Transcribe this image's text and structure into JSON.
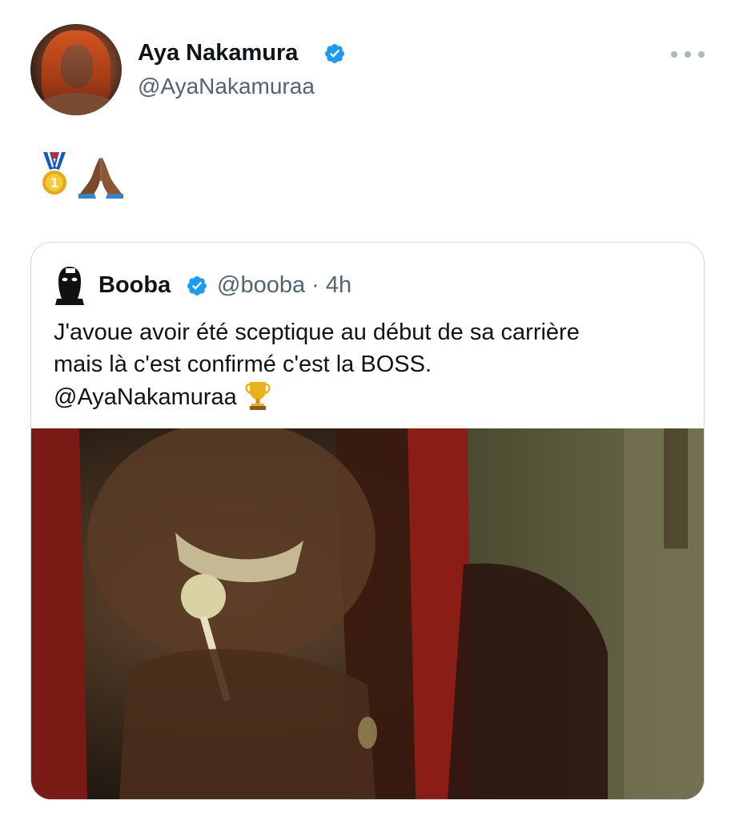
{
  "tweet": {
    "author": {
      "name": "Aya Nakamura",
      "handle": "@AyaNakamuraa",
      "verified": true
    },
    "emojis": [
      "sports-medal",
      "folded-hands"
    ],
    "quoted": {
      "author": {
        "name": "Booba",
        "handle_time": "@booba · 4h",
        "verified": true
      },
      "text_line1": "J'avoue avoir été sceptique au début de sa carrière",
      "text_line2": "mais là c'est confirmé c'est la BOSS.",
      "mention": "@AyaNakamuraa",
      "trophy": "trophy-emoji"
    }
  },
  "colors": {
    "verified": "#1d9bf0",
    "secondary_text": "#536471",
    "border": "#cfd9de"
  }
}
